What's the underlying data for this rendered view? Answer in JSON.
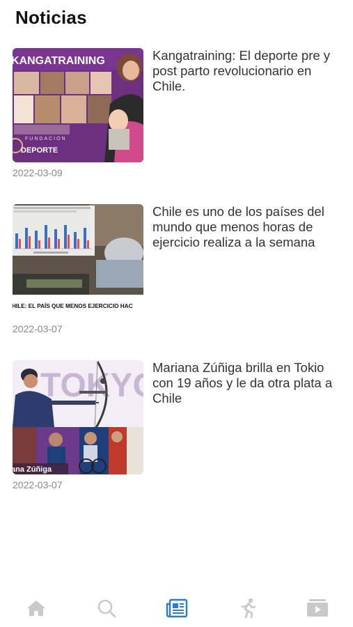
{
  "header": {
    "title": "Noticias"
  },
  "news": [
    {
      "headline": "Kangatraining: El deporte pre y post parto revolucionario en Chile.",
      "date": "2022-03-09",
      "thumb_text_top": "KANGATRAINING",
      "thumb_text_small": "FUNDACION",
      "thumb_text_bottom": "DEPORTE"
    },
    {
      "headline": "Chile es uno de los países del mundo que menos horas de ejercicio realiza a la semana",
      "date": "2022-03-07",
      "thumb_caption": "HILE: EL PAÍS QUE MENOS EJERCICIO HAC"
    },
    {
      "headline": "Mariana Zúñiga brilla en Tokio con 19 años y le da otra plata a Chile",
      "date": "2022-03-07",
      "thumb_bg_text": "TOKYO",
      "thumb_caption": "ana Zúñiga"
    }
  ],
  "tabbar": {
    "tabs": [
      {
        "name": "home",
        "icon": "home-icon"
      },
      {
        "name": "search",
        "icon": "search-icon"
      },
      {
        "name": "news",
        "icon": "newspaper-icon",
        "active": true
      },
      {
        "name": "sports",
        "icon": "runner-icon"
      },
      {
        "name": "videos",
        "icon": "video-icon"
      }
    ],
    "active_color": "#2a7bd6",
    "inactive_color": "#c9c9c9"
  }
}
